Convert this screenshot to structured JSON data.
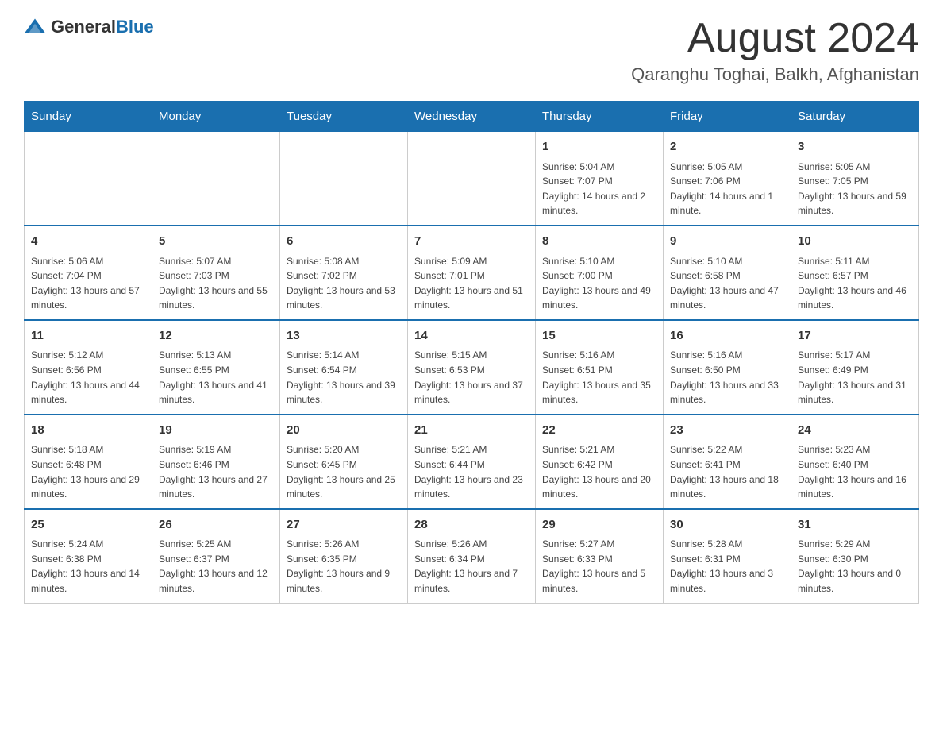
{
  "header": {
    "logo_general": "General",
    "logo_blue": "Blue",
    "month_year": "August 2024",
    "location": "Qaranghu Toghai, Balkh, Afghanistan"
  },
  "days_of_week": [
    "Sunday",
    "Monday",
    "Tuesday",
    "Wednesday",
    "Thursday",
    "Friday",
    "Saturday"
  ],
  "weeks": [
    [
      {
        "day": "",
        "info": ""
      },
      {
        "day": "",
        "info": ""
      },
      {
        "day": "",
        "info": ""
      },
      {
        "day": "",
        "info": ""
      },
      {
        "day": "1",
        "info": "Sunrise: 5:04 AM\nSunset: 7:07 PM\nDaylight: 14 hours and 2 minutes."
      },
      {
        "day": "2",
        "info": "Sunrise: 5:05 AM\nSunset: 7:06 PM\nDaylight: 14 hours and 1 minute."
      },
      {
        "day": "3",
        "info": "Sunrise: 5:05 AM\nSunset: 7:05 PM\nDaylight: 13 hours and 59 minutes."
      }
    ],
    [
      {
        "day": "4",
        "info": "Sunrise: 5:06 AM\nSunset: 7:04 PM\nDaylight: 13 hours and 57 minutes."
      },
      {
        "day": "5",
        "info": "Sunrise: 5:07 AM\nSunset: 7:03 PM\nDaylight: 13 hours and 55 minutes."
      },
      {
        "day": "6",
        "info": "Sunrise: 5:08 AM\nSunset: 7:02 PM\nDaylight: 13 hours and 53 minutes."
      },
      {
        "day": "7",
        "info": "Sunrise: 5:09 AM\nSunset: 7:01 PM\nDaylight: 13 hours and 51 minutes."
      },
      {
        "day": "8",
        "info": "Sunrise: 5:10 AM\nSunset: 7:00 PM\nDaylight: 13 hours and 49 minutes."
      },
      {
        "day": "9",
        "info": "Sunrise: 5:10 AM\nSunset: 6:58 PM\nDaylight: 13 hours and 47 minutes."
      },
      {
        "day": "10",
        "info": "Sunrise: 5:11 AM\nSunset: 6:57 PM\nDaylight: 13 hours and 46 minutes."
      }
    ],
    [
      {
        "day": "11",
        "info": "Sunrise: 5:12 AM\nSunset: 6:56 PM\nDaylight: 13 hours and 44 minutes."
      },
      {
        "day": "12",
        "info": "Sunrise: 5:13 AM\nSunset: 6:55 PM\nDaylight: 13 hours and 41 minutes."
      },
      {
        "day": "13",
        "info": "Sunrise: 5:14 AM\nSunset: 6:54 PM\nDaylight: 13 hours and 39 minutes."
      },
      {
        "day": "14",
        "info": "Sunrise: 5:15 AM\nSunset: 6:53 PM\nDaylight: 13 hours and 37 minutes."
      },
      {
        "day": "15",
        "info": "Sunrise: 5:16 AM\nSunset: 6:51 PM\nDaylight: 13 hours and 35 minutes."
      },
      {
        "day": "16",
        "info": "Sunrise: 5:16 AM\nSunset: 6:50 PM\nDaylight: 13 hours and 33 minutes."
      },
      {
        "day": "17",
        "info": "Sunrise: 5:17 AM\nSunset: 6:49 PM\nDaylight: 13 hours and 31 minutes."
      }
    ],
    [
      {
        "day": "18",
        "info": "Sunrise: 5:18 AM\nSunset: 6:48 PM\nDaylight: 13 hours and 29 minutes."
      },
      {
        "day": "19",
        "info": "Sunrise: 5:19 AM\nSunset: 6:46 PM\nDaylight: 13 hours and 27 minutes."
      },
      {
        "day": "20",
        "info": "Sunrise: 5:20 AM\nSunset: 6:45 PM\nDaylight: 13 hours and 25 minutes."
      },
      {
        "day": "21",
        "info": "Sunrise: 5:21 AM\nSunset: 6:44 PM\nDaylight: 13 hours and 23 minutes."
      },
      {
        "day": "22",
        "info": "Sunrise: 5:21 AM\nSunset: 6:42 PM\nDaylight: 13 hours and 20 minutes."
      },
      {
        "day": "23",
        "info": "Sunrise: 5:22 AM\nSunset: 6:41 PM\nDaylight: 13 hours and 18 minutes."
      },
      {
        "day": "24",
        "info": "Sunrise: 5:23 AM\nSunset: 6:40 PM\nDaylight: 13 hours and 16 minutes."
      }
    ],
    [
      {
        "day": "25",
        "info": "Sunrise: 5:24 AM\nSunset: 6:38 PM\nDaylight: 13 hours and 14 minutes."
      },
      {
        "day": "26",
        "info": "Sunrise: 5:25 AM\nSunset: 6:37 PM\nDaylight: 13 hours and 12 minutes."
      },
      {
        "day": "27",
        "info": "Sunrise: 5:26 AM\nSunset: 6:35 PM\nDaylight: 13 hours and 9 minutes."
      },
      {
        "day": "28",
        "info": "Sunrise: 5:26 AM\nSunset: 6:34 PM\nDaylight: 13 hours and 7 minutes."
      },
      {
        "day": "29",
        "info": "Sunrise: 5:27 AM\nSunset: 6:33 PM\nDaylight: 13 hours and 5 minutes."
      },
      {
        "day": "30",
        "info": "Sunrise: 5:28 AM\nSunset: 6:31 PM\nDaylight: 13 hours and 3 minutes."
      },
      {
        "day": "31",
        "info": "Sunrise: 5:29 AM\nSunset: 6:30 PM\nDaylight: 13 hours and 0 minutes."
      }
    ]
  ]
}
